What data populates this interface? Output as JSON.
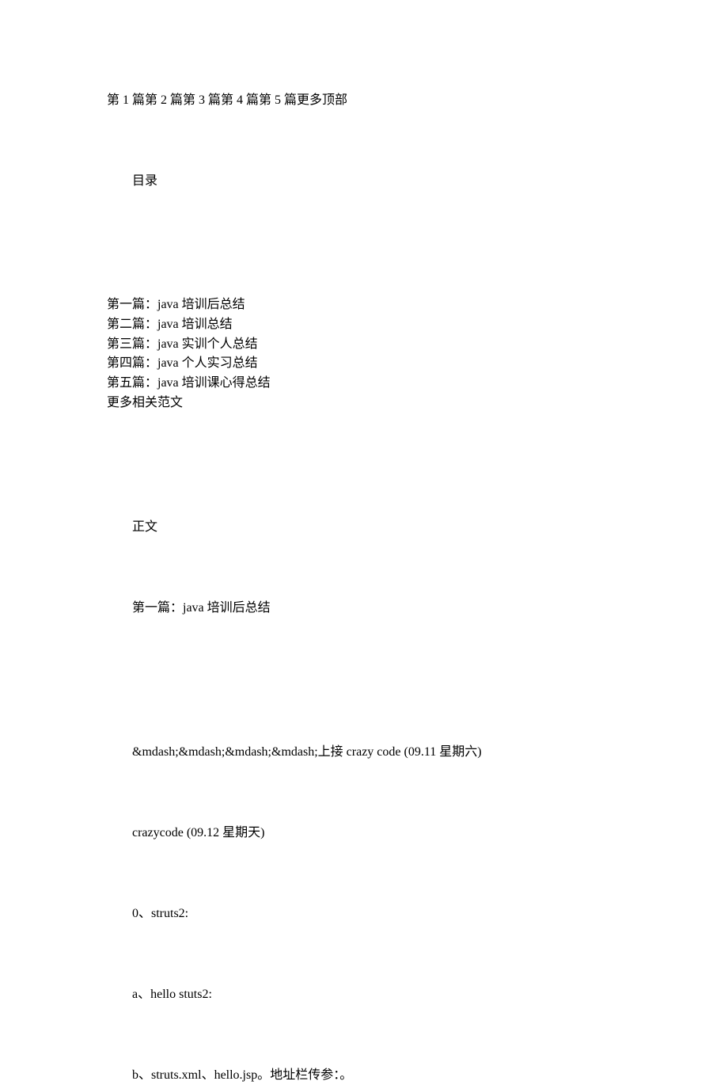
{
  "header": "第 1 篇第 2 篇第 3 篇第 4 篇第 5 篇更多顶部",
  "toc": {
    "title": "目录",
    "items": [
      "第一篇：java 培训后总结",
      "第二篇：java 培训总结",
      "第三篇：java 实训个人总结",
      "第四篇：java 个人实习总结",
      "第五篇：java 培训课心得总结",
      "更多相关范文"
    ]
  },
  "body": {
    "section_label": "正文",
    "article_title": "第一篇：java 培训后总结",
    "paragraphs": [
      "&mdash;&mdash;&mdash;&mdash;上接 crazy code (09.11 星期六)",
      "crazycode (09.12 星期天)",
      "0、struts2:",
      "a、hello stuts2:",
      "b、struts.xml、hello.jsp。地址栏传参：。"
    ]
  }
}
